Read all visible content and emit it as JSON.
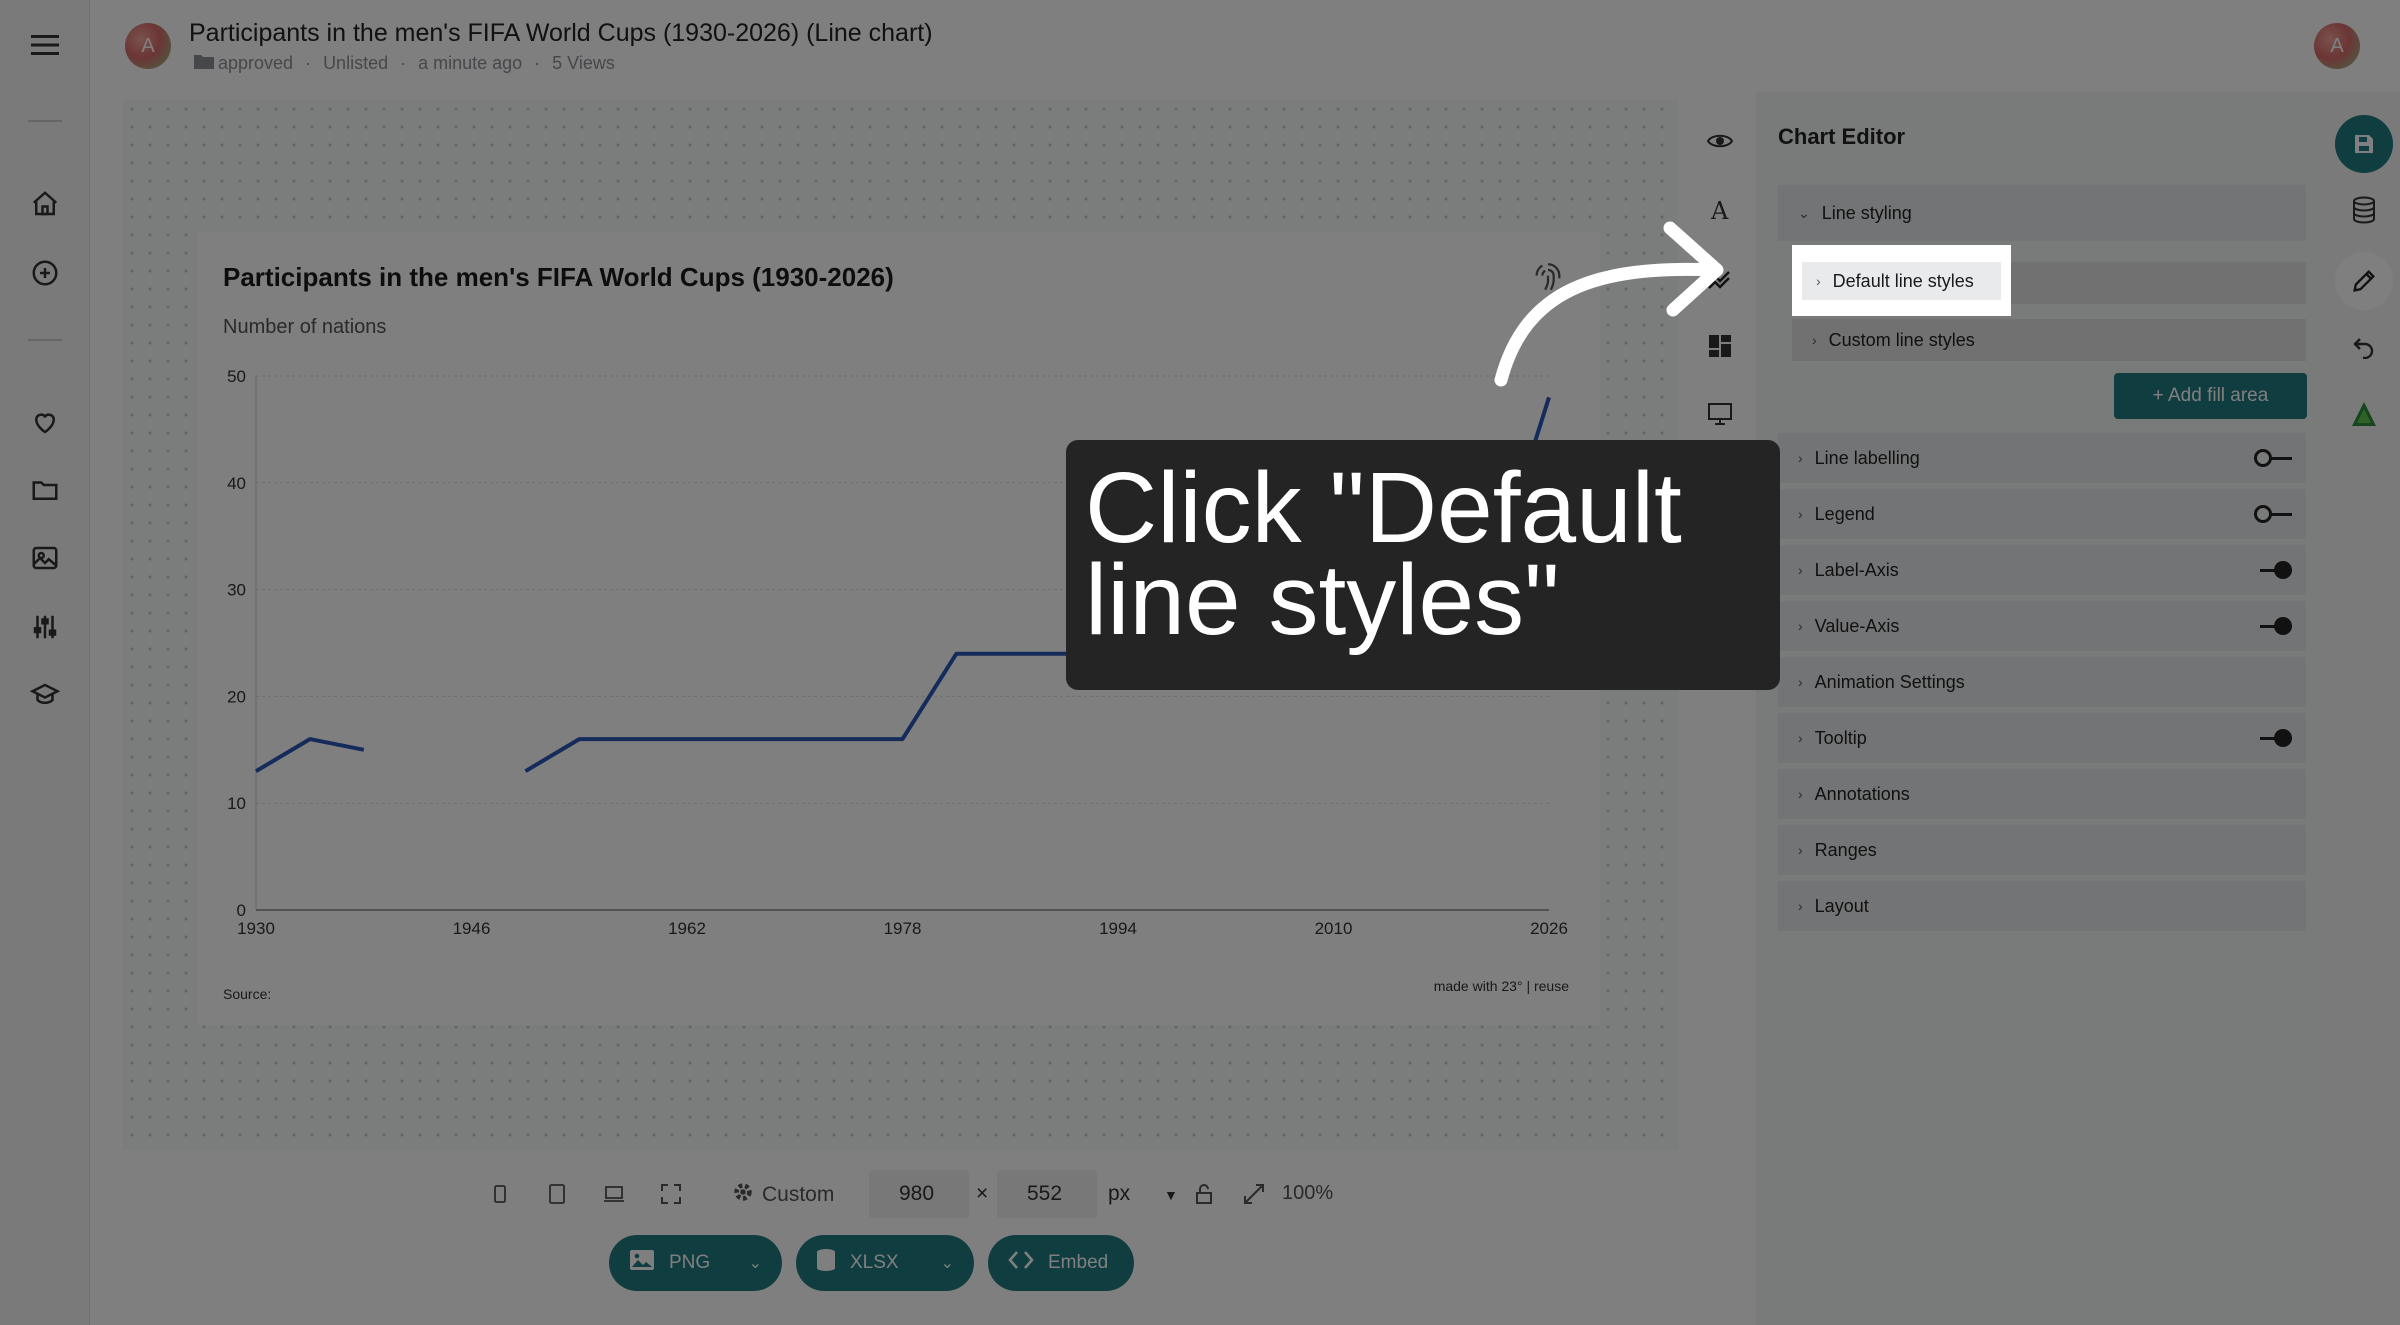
{
  "header": {
    "avatar_letter": "A",
    "title": "Participants in the men's FIFA World Cups (1930-2026) (Line chart)",
    "folder": "approved",
    "visibility": "Unlisted",
    "updated": "a minute ago",
    "views": "5 Views",
    "user_avatar_letter": "A"
  },
  "chart": {
    "title": "Participants in the men's FIFA World Cups (1930-2026)",
    "subtitle": "Number of nations",
    "source": "Source:",
    "made_with": "made with 23° | reuse"
  },
  "chart_data": {
    "type": "line",
    "title": "Participants in the men's FIFA World Cups (1930-2026)",
    "ylabel": "Number of nations",
    "xlim": [
      1930,
      2026
    ],
    "ylim": [
      0,
      50
    ],
    "x_ticks": [
      "1930",
      "1946",
      "1962",
      "1978",
      "1994",
      "2010",
      "2026"
    ],
    "y_ticks": [
      "0",
      "10",
      "20",
      "30",
      "40",
      "50"
    ],
    "grid": true,
    "color": "#2a56b8",
    "series": [
      {
        "points": [
          {
            "x": 1930,
            "y": 13
          },
          {
            "x": 1934,
            "y": 16
          },
          {
            "x": 1938,
            "y": 15
          },
          {
            "x": 1950,
            "y": 13
          },
          {
            "x": 1954,
            "y": 16
          },
          {
            "x": 1958,
            "y": 16
          },
          {
            "x": 1962,
            "y": 16
          },
          {
            "x": 1966,
            "y": 16
          },
          {
            "x": 1970,
            "y": 16
          },
          {
            "x": 1974,
            "y": 16
          },
          {
            "x": 1978,
            "y": 16
          },
          {
            "x": 1982,
            "y": 24
          },
          {
            "x": 1986,
            "y": 24
          },
          {
            "x": 1990,
            "y": 24
          },
          {
            "x": 1994,
            "y": 24
          },
          {
            "x": 1998,
            "y": 32
          },
          {
            "x": 2002,
            "y": 32
          },
          {
            "x": 2006,
            "y": 32
          },
          {
            "x": 2010,
            "y": 32
          },
          {
            "x": 2014,
            "y": 32
          },
          {
            "x": 2018,
            "y": 32
          },
          {
            "x": 2022,
            "y": 32
          },
          {
            "x": 2026,
            "y": 48
          }
        ]
      }
    ]
  },
  "editor": {
    "title": "Chart Editor",
    "sections": {
      "line_styling": "Line styling",
      "default_line_styles": "Default line styles",
      "custom_line_styles": "Custom line styles",
      "add_fill_area": "+ Add fill area",
      "line_labelling": "Line labelling",
      "legend": "Legend",
      "label_axis": "Label-Axis",
      "value_axis": "Value-Axis",
      "animation": "Animation Settings",
      "tooltip": "Tooltip",
      "annotations": "Annotations",
      "ranges": "Ranges",
      "layout": "Layout"
    }
  },
  "bottom": {
    "preset": "Custom",
    "width": "980",
    "height": "552",
    "unit": "px",
    "times": "×",
    "zoom": "100%",
    "png": "PNG",
    "xlsx": "XLSX",
    "embed": "Embed"
  },
  "overlay": {
    "line1": "Click \"Default",
    "line2": "line styles\""
  },
  "colors": {
    "accent": "#1f7a80",
    "line": "#2a56b8",
    "overlay_box": "#242424"
  }
}
